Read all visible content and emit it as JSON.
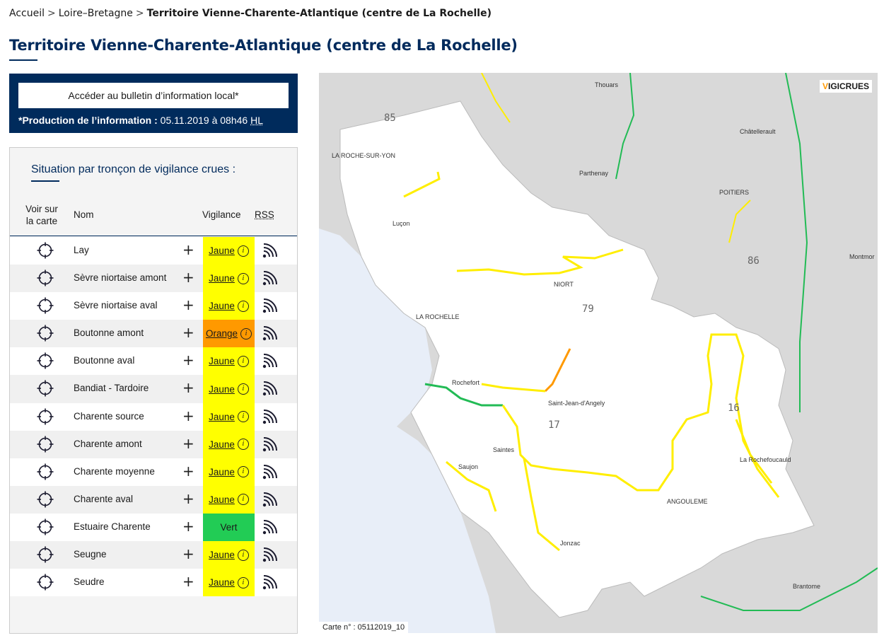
{
  "breadcrumb": {
    "home": "Accueil",
    "region": "Loire–Bretagne",
    "current": "Territoire Vienne-Charente-Atlantique (centre de La Rochelle)"
  },
  "page_title": "Territoire Vienne-Charente-Atlantique (centre de La Rochelle)",
  "info": {
    "bulletin_label": "Accéder au bulletin d’information local*",
    "production_label": "*Production de l’information :",
    "production_value": "05.11.2019 à 08h46",
    "production_tz": "HL"
  },
  "panel": {
    "title": "Situation par tronçon de vigilance crues :",
    "col_map_line1": "Voir sur",
    "col_map_line2": "la carte",
    "col_name": "Nom",
    "col_vigilance": "Vigilance",
    "col_rss": "RSS"
  },
  "colors": {
    "jaune": "#ffff00",
    "orange": "#ff9900",
    "vert": "#22cc55",
    "navy": "#002b5c"
  },
  "troncons": [
    {
      "name": "Lay",
      "level": "Jaune",
      "level_key": "jaune"
    },
    {
      "name": "Sèvre niortaise amont",
      "level": "Jaune",
      "level_key": "jaune"
    },
    {
      "name": "Sèvre niortaise aval",
      "level": "Jaune",
      "level_key": "jaune"
    },
    {
      "name": "Boutonne amont",
      "level": "Orange",
      "level_key": "orange"
    },
    {
      "name": "Boutonne aval",
      "level": "Jaune",
      "level_key": "jaune"
    },
    {
      "name": "Bandiat - Tardoire",
      "level": "Jaune",
      "level_key": "jaune"
    },
    {
      "name": "Charente source",
      "level": "Jaune",
      "level_key": "jaune"
    },
    {
      "name": "Charente amont",
      "level": "Jaune",
      "level_key": "jaune"
    },
    {
      "name": "Charente moyenne",
      "level": "Jaune",
      "level_key": "jaune"
    },
    {
      "name": "Charente aval",
      "level": "Jaune",
      "level_key": "jaune"
    },
    {
      "name": "Estuaire Charente",
      "level": "Vert",
      "level_key": "vert"
    },
    {
      "name": "Seugne",
      "level": "Jaune",
      "level_key": "jaune"
    },
    {
      "name": "Seudre",
      "level": "Jaune",
      "level_key": "jaune"
    }
  ],
  "map": {
    "logo_v": "V",
    "logo_rest": "IGICRUES",
    "carte_label": "Carte n° : 05112019_10",
    "towns": [
      {
        "name": "Thouars"
      },
      {
        "name": "Châtellerault"
      },
      {
        "name": "LA ROCHE-SUR-YON"
      },
      {
        "name": "Parthenay"
      },
      {
        "name": "POITIERS"
      },
      {
        "name": "Luçon"
      },
      {
        "name": "Montmor"
      },
      {
        "name": "NIORT"
      },
      {
        "name": "LA ROCHELLE"
      },
      {
        "name": "Rochefort"
      },
      {
        "name": "Saint-Jean-d'Angely"
      },
      {
        "name": "Saintes"
      },
      {
        "name": "Saujon"
      },
      {
        "name": "La Rochefoucauld"
      },
      {
        "name": "ANGOULEME"
      },
      {
        "name": "Jonzac"
      },
      {
        "name": "Brantome"
      }
    ],
    "departments": [
      "85",
      "86",
      "79",
      "17",
      "16"
    ]
  }
}
